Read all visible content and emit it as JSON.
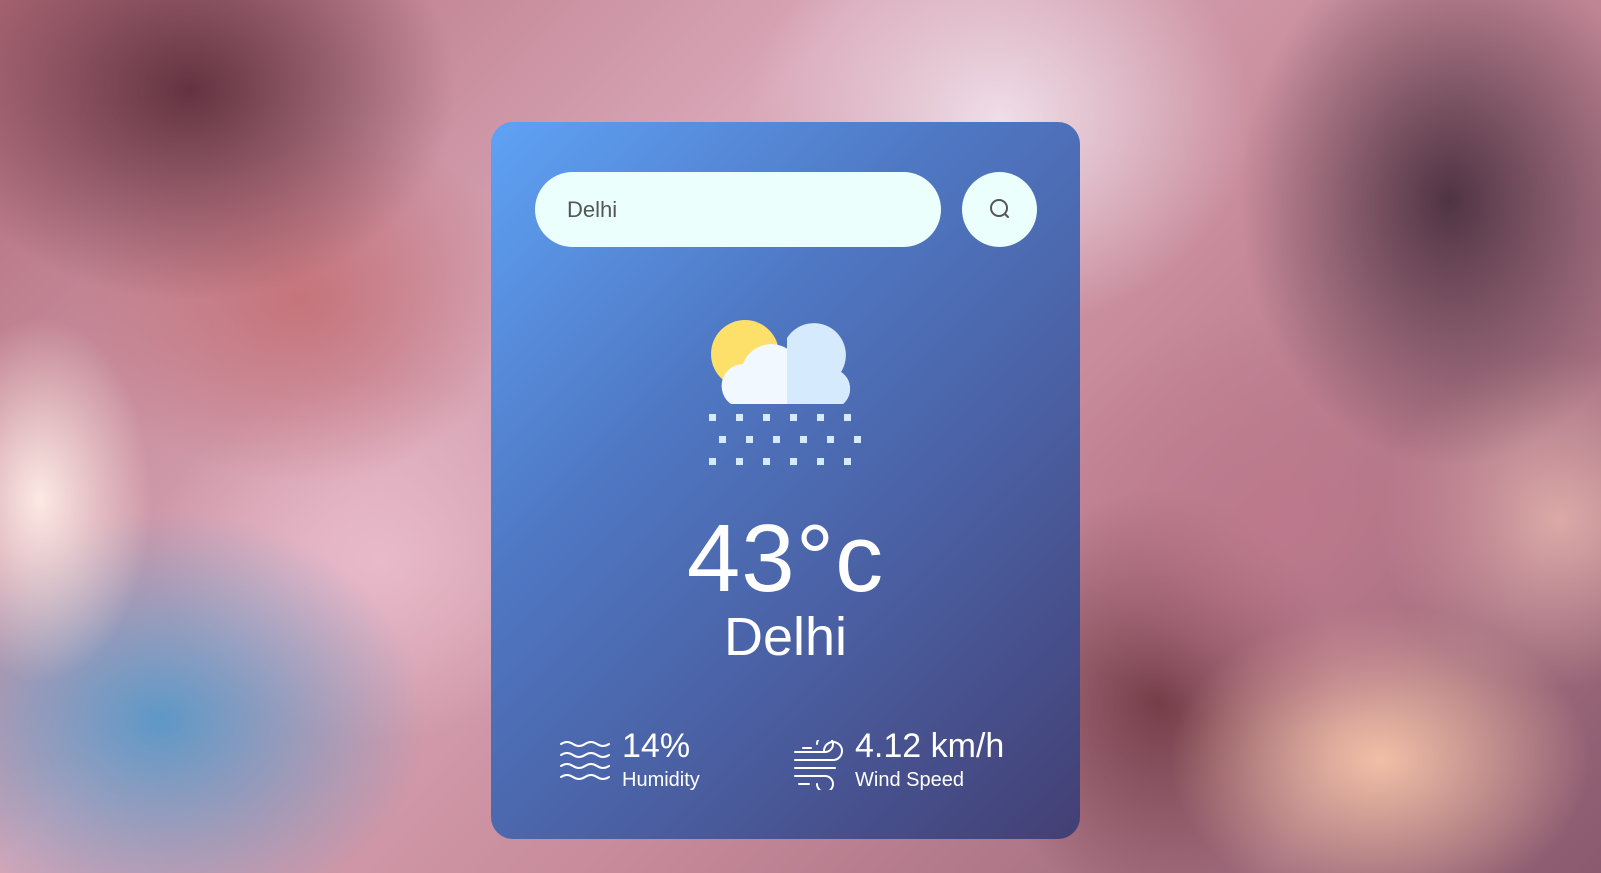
{
  "search": {
    "value": "Delhi",
    "icon": "search-icon"
  },
  "weather": {
    "icon": "sun-cloud-snow-icon",
    "temperature": "43°c",
    "city": "Delhi"
  },
  "details": {
    "humidity": {
      "value": "14%",
      "label": "Humidity",
      "icon": "humidity-waves-icon"
    },
    "wind": {
      "value": "4.12 km/h",
      "label": "Wind Speed",
      "icon": "wind-icon"
    }
  },
  "colors": {
    "card_gradient_start": "#5fa2f5",
    "card_gradient_end": "#433f74",
    "input_background": "#ebfffc",
    "sun": "#fde06a",
    "cloud_light": "#f2f8ff",
    "cloud_shade": "#d6eafd"
  }
}
